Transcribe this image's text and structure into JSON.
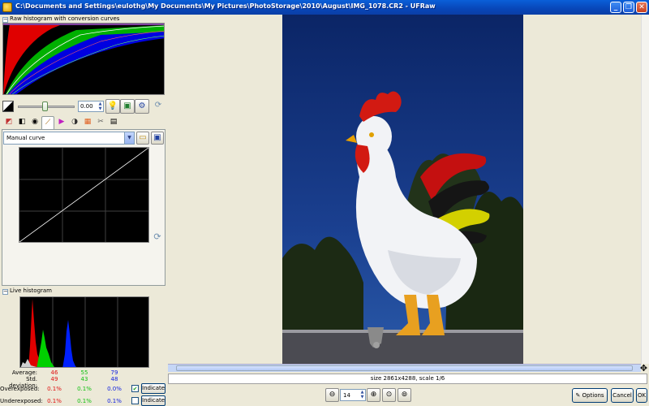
{
  "window": {
    "title": "C:\\Documents and Settings\\eulothg\\My Documents\\My Pictures\\PhotoStorage\\2010\\August\\IMG_1078.CR2 - UFRaw",
    "minimize": "_",
    "maximize": "❐",
    "close": "✕"
  },
  "raw_histogram": {
    "title": "Raw histogram with conversion curves"
  },
  "exposure": {
    "value": "0.00"
  },
  "curve": {
    "selected": "Manual curve"
  },
  "live_histogram": {
    "title": "Live histogram"
  },
  "stats": {
    "average_label": "Average:",
    "average": [
      "46",
      "55",
      "79"
    ],
    "stddev_label": "Std. deviation:",
    "stddev": [
      "49",
      "43",
      "48"
    ],
    "overexposed_label": "Overexposed:",
    "overexposed": [
      "0.1%",
      "0.1%",
      "0.0%"
    ],
    "overexposed_checked": true,
    "underexposed_label": "Underexposed:",
    "underexposed": [
      "0.1%",
      "0.1%",
      "0.1%"
    ],
    "underexposed_checked": false,
    "indicate_label": "Indicate"
  },
  "status": {
    "text": "size 2861x4288, scale 1/6"
  },
  "zoom": {
    "value": "14"
  },
  "buttons": {
    "options": "Options",
    "cancel": "Cancel",
    "ok": "OK"
  },
  "colors": {
    "titlebar": "#0846b8",
    "panel": "#ece9d8",
    "sky": "#1a3f8f"
  }
}
